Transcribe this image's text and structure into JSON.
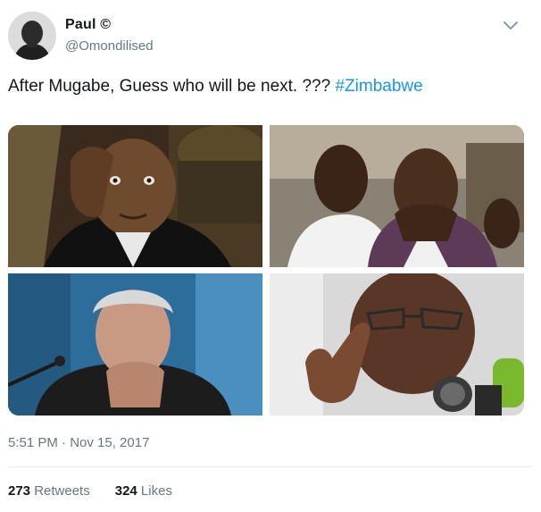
{
  "tweet": {
    "author_name": "Paul ©",
    "author_handle": "@Omondilised",
    "text": "After Mugabe, Guess who will be next. ??? ",
    "hashtag": "#Zimbabwe",
    "timestamp": "5:51 PM · Nov 15, 2017"
  },
  "stats": {
    "retweets_count": "273",
    "retweets_label": " Retweets",
    "likes_count": "324",
    "likes_label": " Likes"
  },
  "icons": {
    "menu": "chevron-down-icon"
  },
  "colors": {
    "text": "#14171a",
    "secondary": "#657786",
    "hashtag": "#1b95e0",
    "divider": "#e6ecf0"
  }
}
